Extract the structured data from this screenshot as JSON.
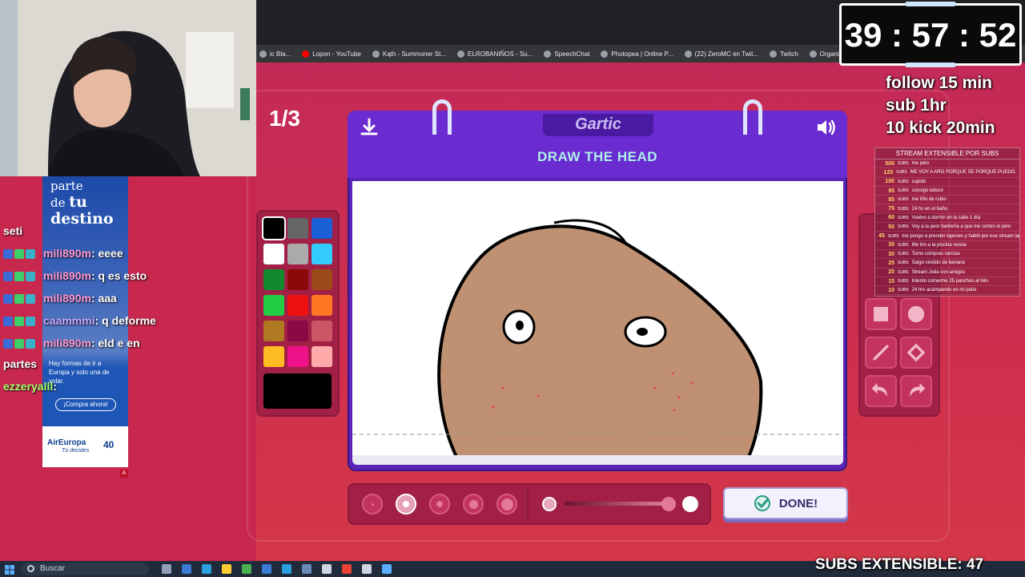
{
  "bookmarks": [
    "ic Bla...",
    "Lopon - YouTube",
    "Kąth - Summoner St...",
    "ELROBANIÑOS - Su...",
    "SpeechChat",
    "Photopea | Online P...",
    "(22) ZeroMC en Twit...",
    "Twitch",
    "Organizador De Za..."
  ],
  "game": {
    "round": "1/3",
    "logo": "Gartic",
    "task": "DRAW THE HEAD",
    "done_label": "DONE!",
    "palette": [
      "#000000",
      "#666666",
      "#1a5fd6",
      "#ffffff",
      "#aaaaaa",
      "#33ccff",
      "#118a2e",
      "#8a0a0a",
      "#9a4a18",
      "#22cc44",
      "#ee1111",
      "#ff7722",
      "#b07a22",
      "#8a0a44",
      "#cc5566",
      "#ffbb22",
      "#ee1188",
      "#ffaaaa"
    ],
    "current_color": "#000000",
    "tools": [
      "square-tool",
      "circle-tool",
      "line-tool",
      "fill-tool",
      "undo",
      "redo"
    ]
  },
  "stream": {
    "timer": "39 : 57 : 52",
    "goal_lines": [
      "follow 15 min",
      "sub 1hr",
      "10 kick 20min"
    ],
    "subs_panel_title": "STREAM EXTENSIBLE POR SUBS",
    "subs_unit": "SUBS",
    "subs_goals": [
      {
        "amount": "500",
        "text": "me pelo"
      },
      {
        "amount": "120",
        "text": "ME VOY A ARG PORQUE SE PORQUE PUEDO."
      },
      {
        "amount": "100",
        "text": "cupido"
      },
      {
        "amount": "95",
        "text": "consigo laburo"
      },
      {
        "amount": "85",
        "text": "me tiño de rubio"
      },
      {
        "amount": "75",
        "text": "24 hs en el baño"
      },
      {
        "amount": "60",
        "text": "Vuelvo a dormir en la calle 1 día"
      },
      {
        "amount": "50",
        "text": "Voy a la peor barbería a que me corten el pelo"
      },
      {
        "amount": "45",
        "text": "me pongo a prender lapenes y habló por ese stream lapenes"
      },
      {
        "amount": "35",
        "text": "Me tiro a la piscina rancia"
      },
      {
        "amount": "30",
        "text": "Tomo compras rancias"
      },
      {
        "amount": "25",
        "text": "Salgo vestido de banana"
      },
      {
        "amount": "20",
        "text": "Stream Joda con amigos"
      },
      {
        "amount": "15",
        "text": "Intento comerme 25 panchos al hilo"
      },
      {
        "amount": "10",
        "text": "24 hrs acampando en mi patio"
      }
    ],
    "subs_extensible": "SUBS EXTENSIBLE: 47"
  },
  "chat": [
    {
      "user": "seti",
      "msg": "",
      "color": "#ffffff"
    },
    {
      "user": "mili890m",
      "msg": ": eeee",
      "color": "#ff9ad5"
    },
    {
      "user": "mili890m",
      "msg": ": q es esto",
      "color": "#ff9ad5"
    },
    {
      "user": "mili890m",
      "msg": ": aaa",
      "color": "#ff9ad5"
    },
    {
      "user": "caammmi",
      "msg": ": q deforme",
      "color": "#c9a8ff"
    },
    {
      "user": "mili890m",
      "msg": ": eld e en",
      "color": "#ff9ad5"
    },
    {
      "user": "partes",
      "msg": "",
      "color": "#ffffff"
    },
    {
      "user": "ezzeryalll",
      "msg": ":",
      "color": "#a8ff6a"
    }
  ],
  "ad": {
    "headline_1": "parte",
    "headline_2": "de",
    "headline_3": "tu",
    "headline_4": "destino",
    "body": "Hay formas de ir a Europa y solo una de volar.",
    "cta": "¡Compra ahora!",
    "brand": "AirEuropa",
    "brand_sub": "Tú decides",
    "badge_40": "40",
    "mark": "A"
  },
  "taskbar": {
    "search_placeholder": "Buscar"
  }
}
